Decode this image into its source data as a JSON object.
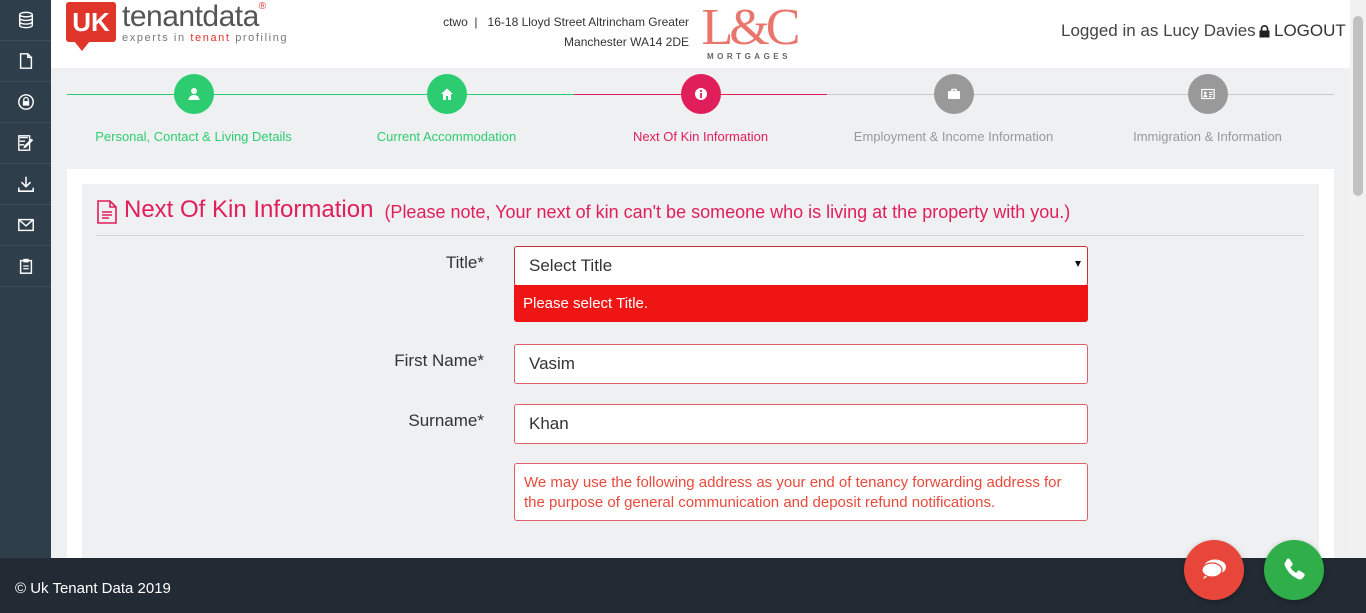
{
  "colors": {
    "sidebar": "#2f3e4b",
    "completed": "#2ecc71",
    "active": "#e01e5a",
    "pending": "#999999",
    "error": "#f01515"
  },
  "sidebar": {
    "items": [
      {
        "icon": "database-icon"
      },
      {
        "icon": "document-icon"
      },
      {
        "icon": "lock-icon"
      },
      {
        "icon": "edit-icon"
      },
      {
        "icon": "download-icon"
      },
      {
        "icon": "mail-icon"
      },
      {
        "icon": "clipboard-icon"
      }
    ]
  },
  "header": {
    "logo": {
      "badge": "UK",
      "name": "tenantdata",
      "reg": "®",
      "tagline_prefix": "experts in ",
      "tagline_highlight": "tenant",
      "tagline_suffix": " profiling"
    },
    "agency_line1": "ctwo  |   16-18 Lloyd Street Altrincham Greater",
    "agency_line2": "Manchester WA14 2DE",
    "partner_logo": {
      "mark": "L&C",
      "sub": "MORTGAGES"
    },
    "user": "Logged in as Lucy Davies",
    "logout": "LOGOUT"
  },
  "steps": [
    {
      "label": "Personal, Contact & Living Details",
      "status": "completed",
      "icon": "user-icon"
    },
    {
      "label": "Current Accommodation",
      "status": "completed",
      "icon": "home-icon"
    },
    {
      "label": "Next Of Kin Information",
      "status": "active",
      "icon": "info-icon"
    },
    {
      "label": "Employment & Income Information",
      "status": "pending",
      "icon": "briefcase-icon"
    },
    {
      "label": "Immigration & Information",
      "status": "pending",
      "icon": "id-card-icon"
    }
  ],
  "form": {
    "title": "Next Of Kin Information",
    "note": "(Please note, Your next of kin can't be someone who is living at the property with you.)",
    "title_label": "Title*",
    "title_value": "Select Title",
    "title_error": "Please select Title.",
    "first_name_label": "First Name*",
    "first_name_value": "Vasim",
    "surname_label": "Surname*",
    "surname_value": "Khan",
    "address_note": "We may use the following address as your end of tenancy forwarding address for the purpose of general communication and deposit refund notifications."
  },
  "footer": {
    "copyright": "© Uk Tenant Data 2019",
    "chat_icon": "chat-icon",
    "phone_icon": "phone-icon"
  }
}
